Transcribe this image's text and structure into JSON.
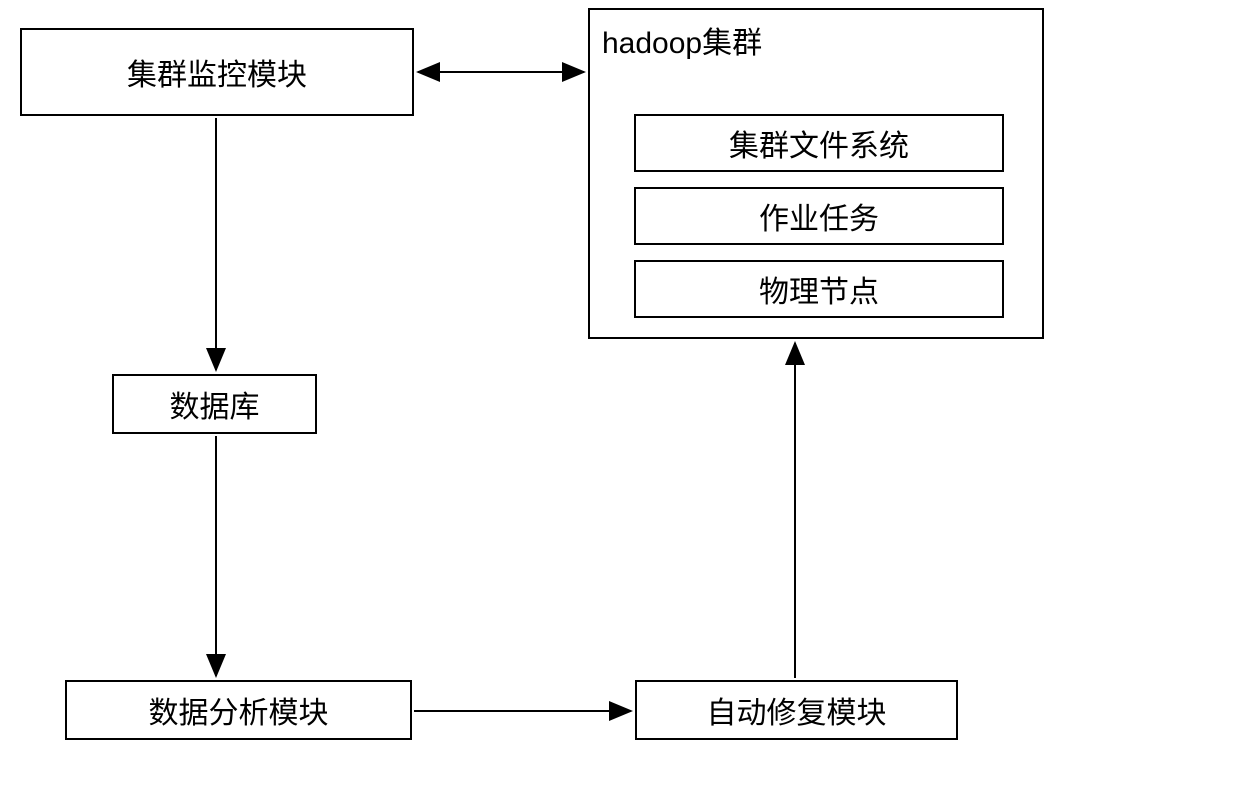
{
  "monitor_module": "集群监控模块",
  "database": "数据库",
  "data_analysis": "数据分析模块",
  "auto_repair": "自动修复模块",
  "hadoop_cluster": {
    "title": "hadoop集群",
    "items": [
      "集群文件系统",
      "作业任务",
      "物理节点"
    ]
  }
}
